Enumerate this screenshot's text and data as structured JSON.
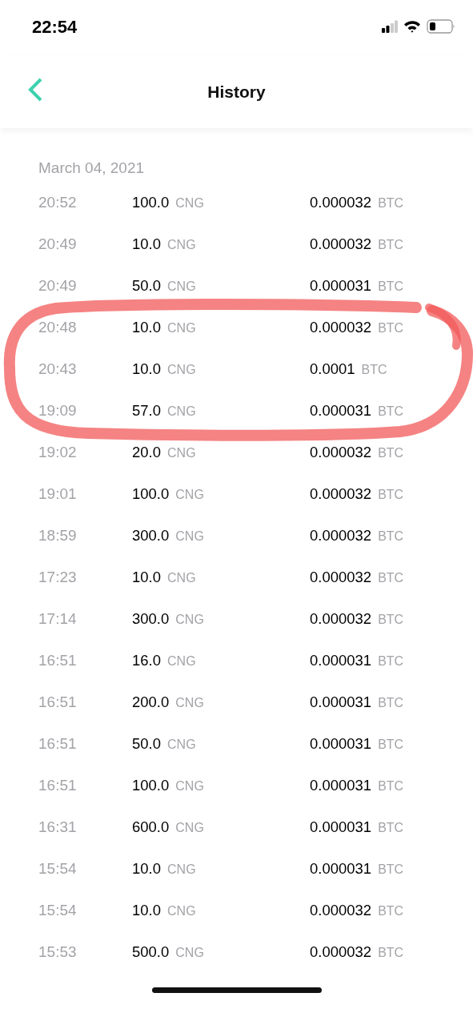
{
  "status_bar": {
    "time": "22:54"
  },
  "header": {
    "title": "History"
  },
  "history": {
    "date": "March 04, 2021",
    "transactions": [
      {
        "time": "20:52",
        "amount": "100.0",
        "amount_unit": "CNG",
        "btc": "0.000032",
        "btc_unit": "BTC"
      },
      {
        "time": "20:49",
        "amount": "10.0",
        "amount_unit": "CNG",
        "btc": "0.000032",
        "btc_unit": "BTC"
      },
      {
        "time": "20:49",
        "amount": "50.0",
        "amount_unit": "CNG",
        "btc": "0.000031",
        "btc_unit": "BTC"
      },
      {
        "time": "20:48",
        "amount": "10.0",
        "amount_unit": "CNG",
        "btc": "0.000032",
        "btc_unit": "BTC"
      },
      {
        "time": "20:43",
        "amount": "10.0",
        "amount_unit": "CNG",
        "btc": "0.0001",
        "btc_unit": "BTC"
      },
      {
        "time": "19:09",
        "amount": "57.0",
        "amount_unit": "CNG",
        "btc": "0.000031",
        "btc_unit": "BTC"
      },
      {
        "time": "19:02",
        "amount": "20.0",
        "amount_unit": "CNG",
        "btc": "0.000032",
        "btc_unit": "BTC"
      },
      {
        "time": "19:01",
        "amount": "100.0",
        "amount_unit": "CNG",
        "btc": "0.000032",
        "btc_unit": "BTC"
      },
      {
        "time": "18:59",
        "amount": "300.0",
        "amount_unit": "CNG",
        "btc": "0.000032",
        "btc_unit": "BTC"
      },
      {
        "time": "17:23",
        "amount": "10.0",
        "amount_unit": "CNG",
        "btc": "0.000032",
        "btc_unit": "BTC"
      },
      {
        "time": "17:14",
        "amount": "300.0",
        "amount_unit": "CNG",
        "btc": "0.000032",
        "btc_unit": "BTC"
      },
      {
        "time": "16:51",
        "amount": "16.0",
        "amount_unit": "CNG",
        "btc": "0.000031",
        "btc_unit": "BTC"
      },
      {
        "time": "16:51",
        "amount": "200.0",
        "amount_unit": "CNG",
        "btc": "0.000031",
        "btc_unit": "BTC"
      },
      {
        "time": "16:51",
        "amount": "50.0",
        "amount_unit": "CNG",
        "btc": "0.000031",
        "btc_unit": "BTC"
      },
      {
        "time": "16:51",
        "amount": "100.0",
        "amount_unit": "CNG",
        "btc": "0.000031",
        "btc_unit": "BTC"
      },
      {
        "time": "16:31",
        "amount": "600.0",
        "amount_unit": "CNG",
        "btc": "0.000031",
        "btc_unit": "BTC"
      },
      {
        "time": "15:54",
        "amount": "10.0",
        "amount_unit": "CNG",
        "btc": "0.000031",
        "btc_unit": "BTC"
      },
      {
        "time": "15:54",
        "amount": "10.0",
        "amount_unit": "CNG",
        "btc": "0.000032",
        "btc_unit": "BTC"
      },
      {
        "time": "15:53",
        "amount": "500.0",
        "amount_unit": "CNG",
        "btc": "0.000032",
        "btc_unit": "BTC"
      }
    ]
  }
}
